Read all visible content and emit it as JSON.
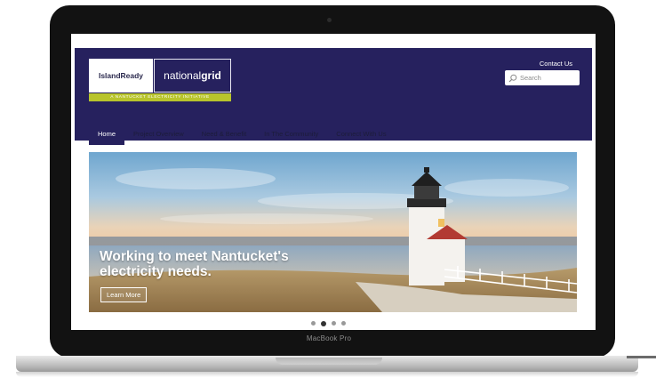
{
  "device": {
    "label": "MacBook Pro"
  },
  "site": {
    "logo": {
      "island_text": "IslandReady",
      "grid_text_light": "national",
      "grid_text_bold": "grid",
      "tagline": "A NANTUCKET ELECTRICITY INITIATIVE"
    },
    "contact_link": "Contact Us",
    "search": {
      "placeholder": "Search"
    },
    "nav": [
      {
        "label": "Home",
        "active": true
      },
      {
        "label": "Project Overview"
      },
      {
        "label": "Need & Benefit"
      },
      {
        "label": "In The Community"
      },
      {
        "label": "Connect With Us"
      }
    ],
    "hero": {
      "headline_line1": "Working to meet Nantucket's",
      "headline_line2": "electricity needs.",
      "button": "Learn More"
    },
    "carousel": {
      "count": 4,
      "active_index": 1
    }
  },
  "colors": {
    "brand": "#26215e",
    "accent": "#b8c42c"
  }
}
